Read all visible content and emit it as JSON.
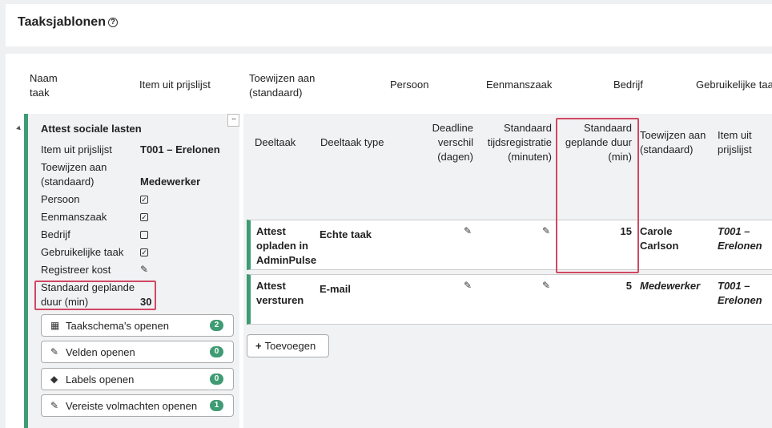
{
  "page": {
    "title": "Taaksjablonen"
  },
  "columns": {
    "naam": "Naam taak",
    "item": "Item uit prijslijst",
    "toewijzen": "Toewijzen aan (standaard)",
    "persoon": "Persoon",
    "eenmanszaak": "Eenmanszaak",
    "bedrijf": "Bedrijf",
    "gebruikelijke": "Gebruikelijke taa"
  },
  "task": {
    "name": "Attest sociale lasten",
    "props": {
      "item_label": "Item uit prijslijst",
      "item_value": "T001 – Erelonen",
      "toewijzen_label": "Toewijzen aan (standaard)",
      "toewijzen_value": "Medewerker",
      "persoon_label": "Persoon",
      "persoon_checked": true,
      "eenmanszaak_label": "Eenmanszaak",
      "eenmanszaak_checked": true,
      "bedrijf_label": "Bedrijf",
      "bedrijf_checked": false,
      "gebruikelijke_label": "Gebruikelijke taak",
      "gebruikelijke_checked": true,
      "kost_label": "Registreer kost",
      "duur_label": "Standaard geplande duur (min)",
      "duur_value": "30"
    },
    "buttons": [
      {
        "label": "Taakschema's openen",
        "badge": "2",
        "icon": "calendar-icon"
      },
      {
        "label": "Velden openen",
        "badge": "0",
        "icon": "edit-icon"
      },
      {
        "label": "Labels openen",
        "badge": "0",
        "icon": "tags-icon"
      },
      {
        "label": "Vereiste volmachten openen",
        "badge": "1",
        "icon": "edit-icon"
      }
    ]
  },
  "subtasks": {
    "headers": {
      "deeltaak": "Deeltaak",
      "type": "Deeltaak type",
      "deadline": "Deadline verschil (dagen)",
      "tijd": "Standaard tijdsregistratie (minuten)",
      "duur": "Standaard geplande duur (min)",
      "toewijzen": "Toewijzen aan (standaard)",
      "item": "Item uit prijslijst"
    },
    "rows": [
      {
        "name": "Attest opladen in AdminPulse",
        "type": "Echte taak",
        "duur": "15",
        "toewijzen": "Carole Carlson",
        "item": "T001 – Erelonen"
      },
      {
        "name": "Attest versturen",
        "type": "E-mail",
        "duur": "5",
        "toewijzen": "Medewerker",
        "item": "T001 – Erelonen"
      }
    ],
    "add_label": "Toevoegen"
  },
  "colors": {
    "accent": "#3f9b73",
    "highlight": "#d14862"
  }
}
